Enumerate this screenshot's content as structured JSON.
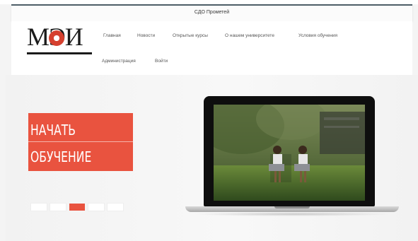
{
  "site": {
    "title": "СДО Прометей"
  },
  "logo": {
    "text": "МЭИ"
  },
  "nav": {
    "items": [
      {
        "label": "Главная"
      },
      {
        "label": "Новости"
      },
      {
        "label": "Открытые курсы"
      },
      {
        "label": "О нашем университете"
      },
      {
        "label": "Условия обучения"
      },
      {
        "label": "Администрация"
      },
      {
        "label": "Войти"
      }
    ]
  },
  "hero": {
    "cta": {
      "line1": "НАЧАТЬ",
      "line2": "ОБУЧЕНИЕ"
    },
    "slides": {
      "count": 5,
      "active_index": 2
    },
    "image_subject": "laptop-showing-children-with-laptops"
  },
  "colors": {
    "accent": "#e9533f",
    "header_bg": "#ffffff",
    "page_bg": "#f4f4f4",
    "title_border": "#4d5e68"
  }
}
